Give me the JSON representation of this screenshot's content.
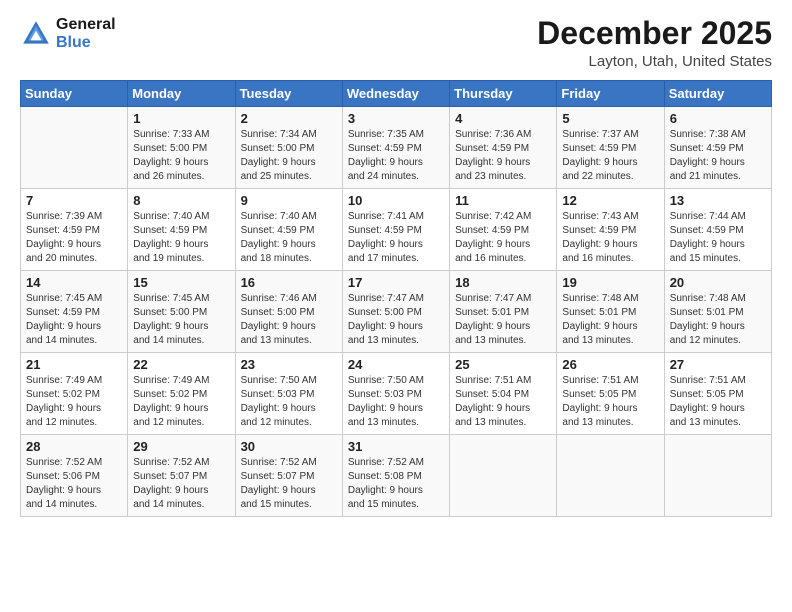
{
  "header": {
    "logo_line1": "General",
    "logo_line2": "Blue",
    "month": "December 2025",
    "location": "Layton, Utah, United States"
  },
  "weekdays": [
    "Sunday",
    "Monday",
    "Tuesday",
    "Wednesday",
    "Thursday",
    "Friday",
    "Saturday"
  ],
  "weeks": [
    [
      {
        "day": "",
        "info": ""
      },
      {
        "day": "1",
        "info": "Sunrise: 7:33 AM\nSunset: 5:00 PM\nDaylight: 9 hours\nand 26 minutes."
      },
      {
        "day": "2",
        "info": "Sunrise: 7:34 AM\nSunset: 5:00 PM\nDaylight: 9 hours\nand 25 minutes."
      },
      {
        "day": "3",
        "info": "Sunrise: 7:35 AM\nSunset: 4:59 PM\nDaylight: 9 hours\nand 24 minutes."
      },
      {
        "day": "4",
        "info": "Sunrise: 7:36 AM\nSunset: 4:59 PM\nDaylight: 9 hours\nand 23 minutes."
      },
      {
        "day": "5",
        "info": "Sunrise: 7:37 AM\nSunset: 4:59 PM\nDaylight: 9 hours\nand 22 minutes."
      },
      {
        "day": "6",
        "info": "Sunrise: 7:38 AM\nSunset: 4:59 PM\nDaylight: 9 hours\nand 21 minutes."
      }
    ],
    [
      {
        "day": "7",
        "info": "Sunrise: 7:39 AM\nSunset: 4:59 PM\nDaylight: 9 hours\nand 20 minutes."
      },
      {
        "day": "8",
        "info": "Sunrise: 7:40 AM\nSunset: 4:59 PM\nDaylight: 9 hours\nand 19 minutes."
      },
      {
        "day": "9",
        "info": "Sunrise: 7:40 AM\nSunset: 4:59 PM\nDaylight: 9 hours\nand 18 minutes."
      },
      {
        "day": "10",
        "info": "Sunrise: 7:41 AM\nSunset: 4:59 PM\nDaylight: 9 hours\nand 17 minutes."
      },
      {
        "day": "11",
        "info": "Sunrise: 7:42 AM\nSunset: 4:59 PM\nDaylight: 9 hours\nand 16 minutes."
      },
      {
        "day": "12",
        "info": "Sunrise: 7:43 AM\nSunset: 4:59 PM\nDaylight: 9 hours\nand 16 minutes."
      },
      {
        "day": "13",
        "info": "Sunrise: 7:44 AM\nSunset: 4:59 PM\nDaylight: 9 hours\nand 15 minutes."
      }
    ],
    [
      {
        "day": "14",
        "info": "Sunrise: 7:45 AM\nSunset: 4:59 PM\nDaylight: 9 hours\nand 14 minutes."
      },
      {
        "day": "15",
        "info": "Sunrise: 7:45 AM\nSunset: 5:00 PM\nDaylight: 9 hours\nand 14 minutes."
      },
      {
        "day": "16",
        "info": "Sunrise: 7:46 AM\nSunset: 5:00 PM\nDaylight: 9 hours\nand 13 minutes."
      },
      {
        "day": "17",
        "info": "Sunrise: 7:47 AM\nSunset: 5:00 PM\nDaylight: 9 hours\nand 13 minutes."
      },
      {
        "day": "18",
        "info": "Sunrise: 7:47 AM\nSunset: 5:01 PM\nDaylight: 9 hours\nand 13 minutes."
      },
      {
        "day": "19",
        "info": "Sunrise: 7:48 AM\nSunset: 5:01 PM\nDaylight: 9 hours\nand 13 minutes."
      },
      {
        "day": "20",
        "info": "Sunrise: 7:48 AM\nSunset: 5:01 PM\nDaylight: 9 hours\nand 12 minutes."
      }
    ],
    [
      {
        "day": "21",
        "info": "Sunrise: 7:49 AM\nSunset: 5:02 PM\nDaylight: 9 hours\nand 12 minutes."
      },
      {
        "day": "22",
        "info": "Sunrise: 7:49 AM\nSunset: 5:02 PM\nDaylight: 9 hours\nand 12 minutes."
      },
      {
        "day": "23",
        "info": "Sunrise: 7:50 AM\nSunset: 5:03 PM\nDaylight: 9 hours\nand 12 minutes."
      },
      {
        "day": "24",
        "info": "Sunrise: 7:50 AM\nSunset: 5:03 PM\nDaylight: 9 hours\nand 13 minutes."
      },
      {
        "day": "25",
        "info": "Sunrise: 7:51 AM\nSunset: 5:04 PM\nDaylight: 9 hours\nand 13 minutes."
      },
      {
        "day": "26",
        "info": "Sunrise: 7:51 AM\nSunset: 5:05 PM\nDaylight: 9 hours\nand 13 minutes."
      },
      {
        "day": "27",
        "info": "Sunrise: 7:51 AM\nSunset: 5:05 PM\nDaylight: 9 hours\nand 13 minutes."
      }
    ],
    [
      {
        "day": "28",
        "info": "Sunrise: 7:52 AM\nSunset: 5:06 PM\nDaylight: 9 hours\nand 14 minutes."
      },
      {
        "day": "29",
        "info": "Sunrise: 7:52 AM\nSunset: 5:07 PM\nDaylight: 9 hours\nand 14 minutes."
      },
      {
        "day": "30",
        "info": "Sunrise: 7:52 AM\nSunset: 5:07 PM\nDaylight: 9 hours\nand 15 minutes."
      },
      {
        "day": "31",
        "info": "Sunrise: 7:52 AM\nSunset: 5:08 PM\nDaylight: 9 hours\nand 15 minutes."
      },
      {
        "day": "",
        "info": ""
      },
      {
        "day": "",
        "info": ""
      },
      {
        "day": "",
        "info": ""
      }
    ]
  ]
}
